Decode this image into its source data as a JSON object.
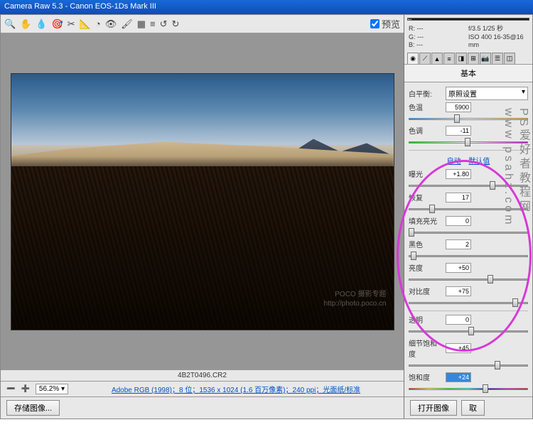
{
  "titlebar": "Camera Raw 5.3  -  Canon EOS-1Ds Mark III",
  "toolbar": {
    "preview_label": "预览"
  },
  "image": {
    "watermark_line1": "POCO 摄影专题",
    "watermark_line2": "http://photo.poco.cn",
    "filename": "4B2T0496.CR2"
  },
  "zoom": {
    "level": "56.2%"
  },
  "info": "Adobe RGB (1998)；8 位；1536 x 1024 (1.6 百万像素)；240 ppi；光面纸/标准",
  "exif": {
    "r": "R: ---",
    "g": "G: ---",
    "b": "B: ---",
    "aperture": "f/3.5  1/25 秒",
    "iso": "ISO 400   16-35@16 mm"
  },
  "panel": {
    "title": "基本",
    "wb_label": "白平衡:",
    "wb_value": "原照设置",
    "temp_label": "色温",
    "temp_value": "5900",
    "tint_label": "色调",
    "tint_value": "-11",
    "auto": "自动",
    "default": "默认值",
    "exposure_label": "曝光",
    "exposure_value": "+1.80",
    "recovery_label": "恢复",
    "recovery_value": "17",
    "fill_label": "填充亮光",
    "fill_value": "0",
    "black_label": "黑色",
    "black_value": "2",
    "brightness_label": "亮度",
    "brightness_value": "+50",
    "contrast_label": "对比度",
    "contrast_value": "+75",
    "clarity_label": "透明",
    "clarity_value": "0",
    "vibrance_label": "细节饱和度",
    "vibrance_value": "+45",
    "saturation_label": "饱和度",
    "saturation_value": "+24"
  },
  "buttons": {
    "save": "存储图像...",
    "open": "打开图像",
    "cancel": "取"
  },
  "side_text": "PS爱好者教程网  www.psahz.com"
}
